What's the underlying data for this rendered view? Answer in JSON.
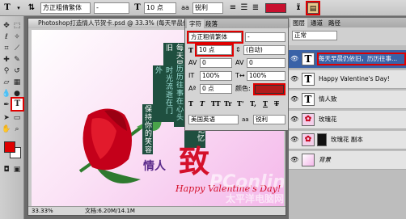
{
  "options_bar": {
    "tool_icon": "T",
    "font_family": "方正粗倩繁体",
    "font_style": "-",
    "font_size": "10 点",
    "antialias": "锐利",
    "color_swatch": "#c8102e",
    "warp_icon": "warp-text-icon",
    "panel_toggle_icon": "character-panel-icon"
  },
  "document": {
    "title": "Photoshop打造情人节贺卡.psd @ 33.3% (每天早晨仍依旧，历历往事...",
    "zoom": "33.33%",
    "doc_size": "文档:6.20M/14.1M",
    "canvas_texts": {
      "col1": "每天早晨仍依旧",
      "col2": "历历往事在心头",
      "col3": "那些诗句在记忆里",
      "col4": "时光流逝在门外",
      "col5": "保持你的笑容",
      "heading_small": "情人",
      "heading_big": "致",
      "script": "Happy Valentine's Day!"
    },
    "watermark_line1": "PConline",
    "watermark_line2": "太平洋电脑网"
  },
  "character_panel": {
    "tab_char": "字符",
    "tab_para": "段落",
    "font_family": "方正粗倩繁体",
    "font_style": "-",
    "size": "10 点",
    "leading": "(自动)",
    "kerning": "0",
    "tracking": "0",
    "vscale": "100%",
    "hscale": "100%",
    "baseline": "0 点",
    "color_label": "颜色:",
    "color_swatch": "#b01b1b",
    "style_buttons": [
      "T",
      "T",
      "TT",
      "Tr",
      "T'",
      "T,",
      "T",
      "T"
    ],
    "language": "美国英语",
    "antialias_label": "aa",
    "antialias": "锐利"
  },
  "layers_panel": {
    "tabs": [
      "图层",
      "通道",
      "路径"
    ],
    "blend_mode": "正常",
    "layers": [
      {
        "name": "每天早晨仍依旧，历历往事...",
        "type": "text",
        "selected": true
      },
      {
        "name": "Happy Valentine's Day!",
        "type": "text",
        "selected": false
      },
      {
        "name": "情人致",
        "type": "text",
        "selected": false
      },
      {
        "name": "玫瑰花",
        "type": "image",
        "selected": false
      },
      {
        "name": "玫瑰花 副本",
        "type": "image",
        "selected": false
      },
      {
        "name": "背景",
        "type": "background",
        "selected": false
      }
    ]
  },
  "toolbox": {
    "foreground": "#e00000",
    "background": "#ffffff"
  }
}
